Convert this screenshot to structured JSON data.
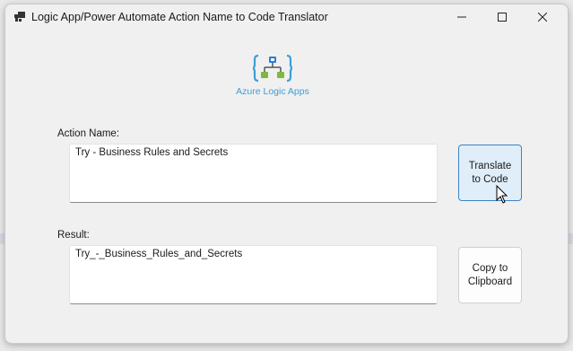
{
  "window": {
    "title": "Logic App/Power Automate Action Name to Code Translator"
  },
  "logo": {
    "caption": "Azure Logic Apps",
    "icon": "logic-apps-workflow-icon",
    "accent": "#3aa0d7"
  },
  "form": {
    "action_label": "Action Name:",
    "action_value": "Try - Business Rules and Secrets",
    "result_label": "Result:",
    "result_value": "Try_-_Business_Rules_and_Secrets"
  },
  "buttons": {
    "translate_line1": "Translate",
    "translate_line2": "to Code",
    "copy_line1": "Copy to",
    "copy_line2": "Clipboard"
  },
  "colors": {
    "translate_border": "#3c83c8",
    "translate_bg": "#e0eef9",
    "window_bg": "#f0f0f0"
  }
}
